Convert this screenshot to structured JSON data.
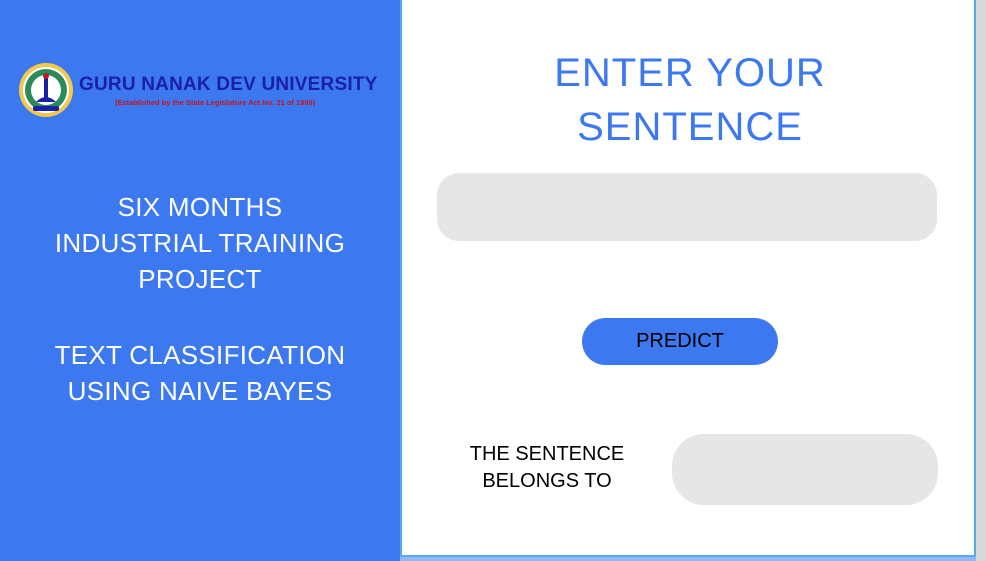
{
  "colors": {
    "accent": "#3c78f0",
    "panel_border": "#5aa7ea",
    "field_bg": "#e6e6e6",
    "logo_blue": "#1a1fa8",
    "logo_red": "#c4161c"
  },
  "logo": {
    "icon": "university-emblem-icon",
    "name": "GURU NANAK DEV UNIVERSITY",
    "subtitle": "(Established by the State Legislature Act No. 21 of 1969)"
  },
  "left_panel": {
    "training_title": [
      "SIX MONTHS",
      "INDUSTRIAL TRAINING",
      "PROJECT"
    ],
    "project_title": [
      "TEXT CLASSIFICATION",
      "USING NAIVE BAYES"
    ]
  },
  "right_panel": {
    "heading": [
      "ENTER YOUR",
      "SENTENCE"
    ],
    "sentence_input": {
      "value": "",
      "placeholder": ""
    },
    "predict_label": "PREDICT",
    "result_label": [
      "THE SENTENCE",
      "BELONGS TO"
    ],
    "result_value": ""
  }
}
